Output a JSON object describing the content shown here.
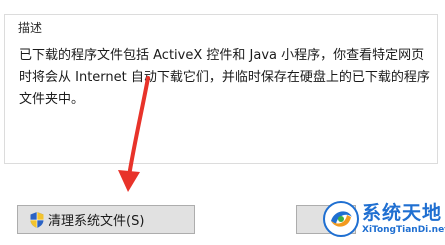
{
  "group": {
    "title": "描述"
  },
  "description": {
    "text": "已下载的程序文件包括 ActiveX 控件和 Java 小程序，你查看特定网页时将会从 Internet 自动下载它们，并临时保存在硬盘上的已下载的程序文件夹中。"
  },
  "buttons": {
    "cleanup_label": "清理系统文件(S)"
  },
  "watermark": {
    "title": "系统天地",
    "url": "XiTongTianDi.net"
  },
  "icons": {
    "cleanup_button_icon": "uac-shield-icon",
    "watermark_logo": "watermark-logo-icon"
  },
  "colors": {
    "arrow": "#e8332a",
    "watermark": "#1f6fd1",
    "button_face": "#e1e1e1"
  }
}
